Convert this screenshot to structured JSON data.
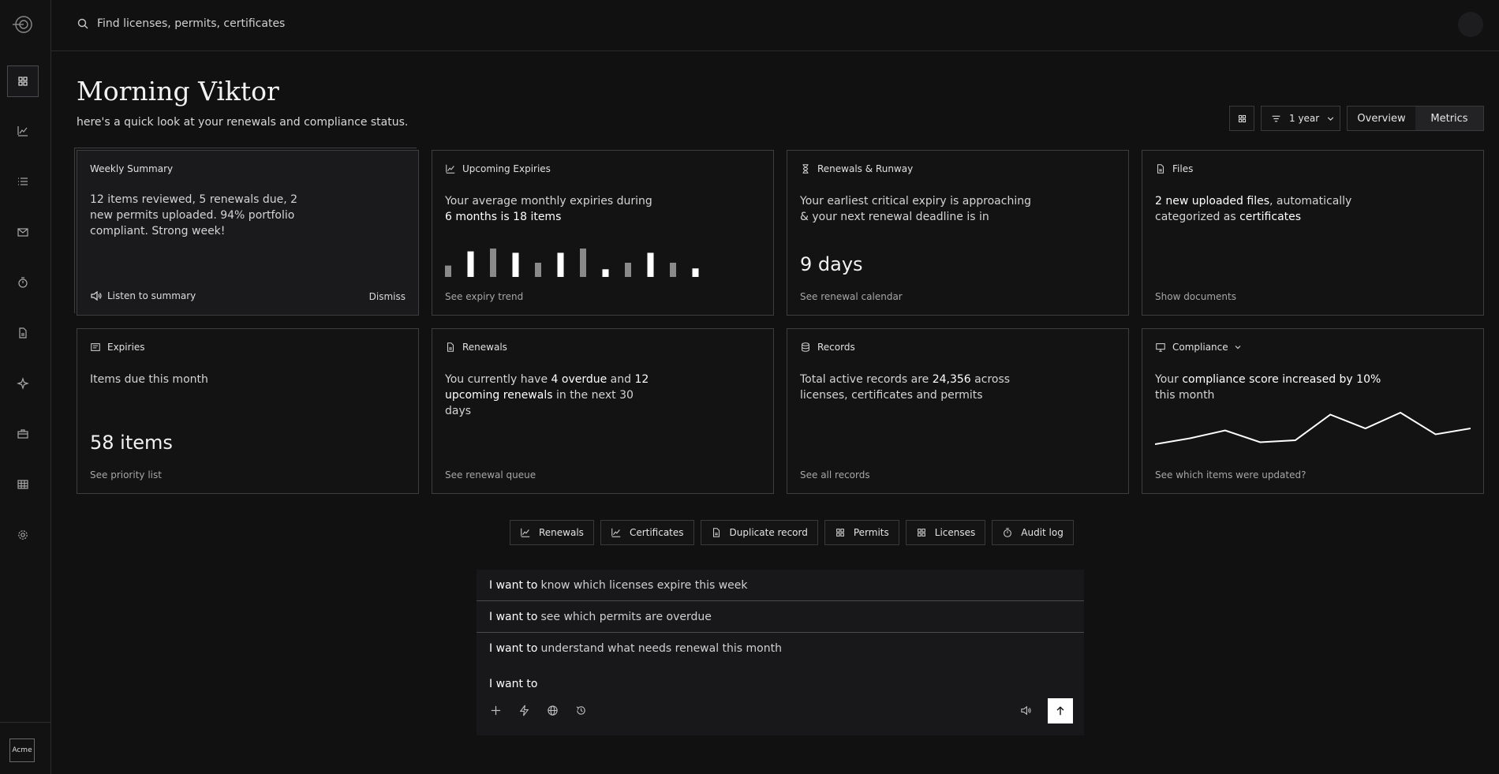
{
  "sidebar": {
    "org_badge": "Acme",
    "items": [
      {
        "name": "dashboard",
        "icon": "grid-icon",
        "active": true
      },
      {
        "name": "analytics",
        "icon": "chart-line-icon",
        "active": false
      },
      {
        "name": "list",
        "icon": "list-icon",
        "active": false
      },
      {
        "name": "inbox",
        "icon": "mail-icon",
        "active": false
      },
      {
        "name": "timer",
        "icon": "stopwatch-icon",
        "active": false
      },
      {
        "name": "documents",
        "icon": "file-icon",
        "active": false
      },
      {
        "name": "assistant",
        "icon": "sparkle-icon",
        "active": false
      },
      {
        "name": "cases",
        "icon": "briefcase-icon",
        "active": false
      },
      {
        "name": "tables",
        "icon": "table-icon",
        "active": false
      },
      {
        "name": "settings",
        "icon": "gear-icon",
        "active": false
      }
    ]
  },
  "search": {
    "placeholder": "Find licenses, permits, certificates"
  },
  "header": {
    "greeting": "Morning Viktor",
    "subtitle": "here's a quick look at your renewals and compliance status.",
    "period": "1 year",
    "views": [
      "Overview",
      "Metrics"
    ]
  },
  "cards": {
    "weekly": {
      "title": "Weekly Summary",
      "body": "12 items reviewed, 5 renewals due, 2 new permits uploaded. 94% portfolio compliant. Strong week!",
      "listen": "Listen to summary",
      "dismiss": "Dismiss"
    },
    "upcoming": {
      "title": "Upcoming Expiries",
      "body_pre": "Your average monthly expiries during ",
      "body_bold": "6 months is 18 items",
      "link": "See expiry trend",
      "bars": [
        {
          "value": 0.4,
          "color": "#8a8a8a"
        },
        {
          "value": 0.9,
          "color": "#ffffff"
        },
        {
          "value": 1.0,
          "color": "#8a8a8a"
        },
        {
          "value": 0.85,
          "color": "#ffffff"
        },
        {
          "value": 0.5,
          "color": "#8a8a8a"
        },
        {
          "value": 0.85,
          "color": "#ffffff"
        },
        {
          "value": 1.0,
          "color": "#8a8a8a"
        },
        {
          "value": 0.27,
          "color": "#ffffff"
        },
        {
          "value": 0.5,
          "color": "#8a8a8a"
        },
        {
          "value": 0.85,
          "color": "#ffffff"
        },
        {
          "value": 0.5,
          "color": "#8a8a8a"
        },
        {
          "value": 0.3,
          "color": "#ffffff"
        }
      ]
    },
    "renewals_runway": {
      "title": "Renewals & Runway",
      "body": "Your earliest critical expiry is approaching & your next renewal deadline is in",
      "value": "9 days",
      "link": "See renewal calendar"
    },
    "files": {
      "title": "Files",
      "bold1": "2 new uploaded files",
      "mid": ", automatically categorized as ",
      "bold2": "certificates",
      "link": "Show documents"
    },
    "expiries": {
      "title": "Expiries",
      "body": "Items due this month",
      "value": "58 items",
      "link": "See priority list"
    },
    "renewals": {
      "title": "Renewals",
      "pre": "You currently have ",
      "bold1": "4 overdue",
      "mid": " and ",
      "bold2": "12 upcoming renewals",
      "post": " in the next 30 days",
      "link": "See renewal queue"
    },
    "records": {
      "title": "Records",
      "pre": "Total active records are ",
      "bold": "24,356",
      "post": " across licenses, certificates and permits",
      "link": "See all records"
    },
    "compliance": {
      "title": "Compliance",
      "pre": "Your ",
      "bold": "compliance score increased by 10%",
      "post": " this month",
      "link": "See which items were updated?",
      "trend": [
        0.2,
        0.35,
        0.55,
        0.25,
        0.3,
        0.95,
        0.6,
        1.0,
        0.45,
        0.6
      ]
    }
  },
  "chips": [
    {
      "label": "Renewals",
      "icon": "chart-line-icon"
    },
    {
      "label": "Certificates",
      "icon": "chart-line-icon"
    },
    {
      "label": "Duplicate record",
      "icon": "file-icon"
    },
    {
      "label": "Permits",
      "icon": "grid-icon"
    },
    {
      "label": "Licenses",
      "icon": "grid-icon"
    },
    {
      "label": "Audit log",
      "icon": "stopwatch-icon"
    }
  ],
  "prompt": {
    "lead": "I want to",
    "suggestions": [
      "know which licenses expire this week",
      "see which permits are overdue",
      "understand what needs renewal this month"
    ]
  },
  "colors": {
    "background": "#111112",
    "border": "#3e3e40",
    "accent": "#ffffff",
    "muted": "#a6a6a6"
  }
}
